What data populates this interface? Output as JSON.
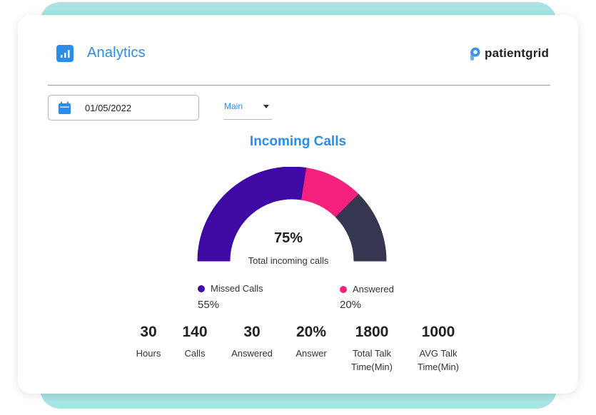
{
  "header": {
    "title": "Analytics",
    "logo": "patientgrid"
  },
  "filters": {
    "date": "01/05/2022",
    "select_value": "Main"
  },
  "chart_title": "Incoming Calls",
  "chart_data": {
    "type": "pie",
    "title": "Incoming Calls",
    "center_value": "75%",
    "center_label": "Total incoming calls",
    "segments": [
      {
        "name": "Missed Calls",
        "value": 55,
        "color": "#3e0aa3"
      },
      {
        "name": "Answered",
        "value": 20,
        "color": "#f5217f"
      },
      {
        "name": "",
        "value": 25,
        "color": "#363651"
      }
    ]
  },
  "legend": [
    {
      "label": "Missed Calls",
      "value": "55%",
      "color": "#3e0aa3"
    },
    {
      "label": "Answered",
      "value": "20%",
      "color": "#f5217f"
    }
  ],
  "stats": [
    {
      "value": "30",
      "label": "Hours"
    },
    {
      "value": "140",
      "label": "Calls"
    },
    {
      "value": "30",
      "label": "Answered"
    },
    {
      "value": "20%",
      "label": "Answer"
    },
    {
      "value": "1800",
      "label": "Total Talk Time(Min)"
    },
    {
      "value": "1000",
      "label": "AVG Talk Time(Min)"
    }
  ],
  "colors": {
    "accent": "#2a8dea",
    "teal": "#a8e4e2"
  }
}
